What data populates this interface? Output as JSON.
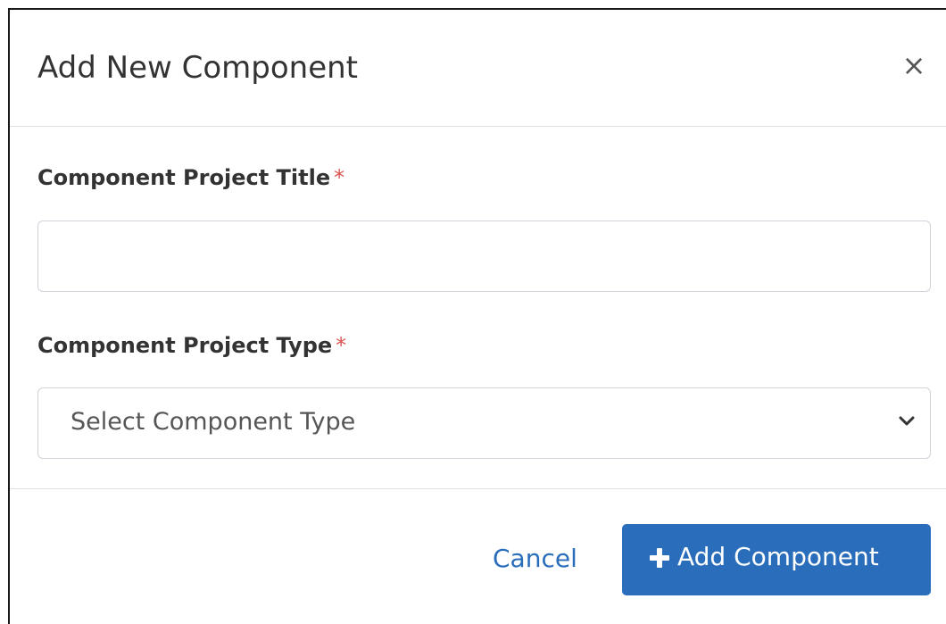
{
  "dialog": {
    "title": "Add New Component",
    "close_label": "×"
  },
  "form": {
    "title_field": {
      "label": "Component Project Title",
      "required_marker": "*",
      "value": "",
      "placeholder": ""
    },
    "type_field": {
      "label": "Component Project Type",
      "required_marker": "*",
      "selected": "Select Component Type"
    }
  },
  "footer": {
    "cancel_label": "Cancel",
    "add_label": "Add Component"
  },
  "icons": {
    "close": "close-icon",
    "dropdown": "chevron-down-icon",
    "add": "plus-icon"
  },
  "colors": {
    "primary": "#2a6ebb",
    "required": "#d9534f",
    "border": "#ced4da"
  }
}
